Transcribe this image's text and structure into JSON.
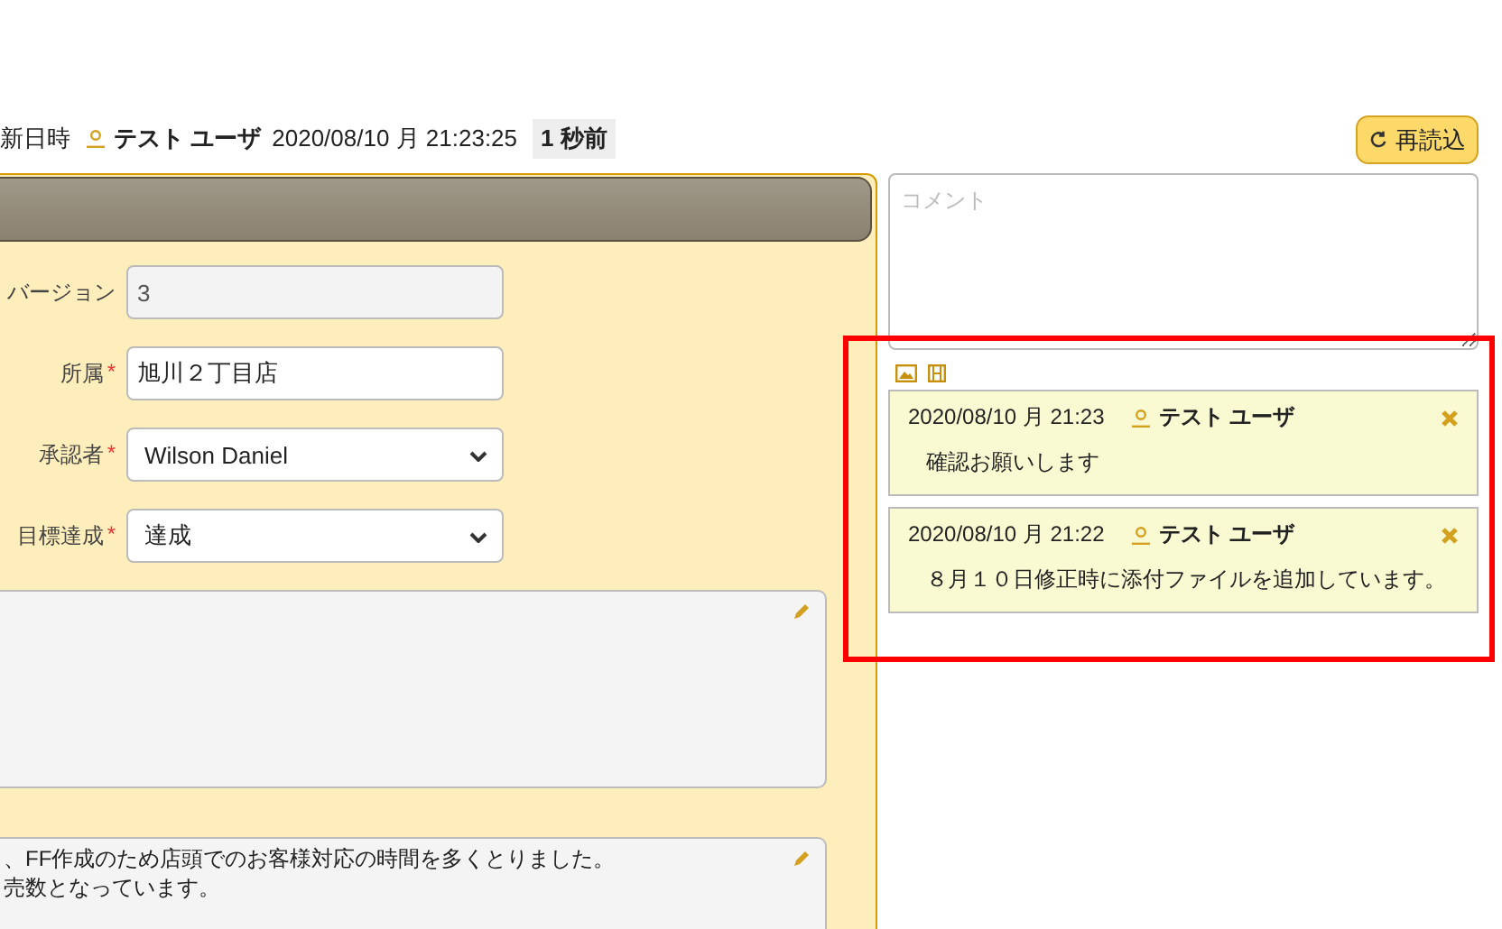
{
  "header": {
    "label": "新日時",
    "user": "テスト ユーザ",
    "timestamp": "2020/08/10 月 21:23:25",
    "ago": "1 秒前"
  },
  "reload_button": {
    "label": "再読込"
  },
  "required_mark": "*",
  "form": {
    "fields": [
      {
        "kind": "readonly",
        "label": "バージョン",
        "required": false,
        "value": "3"
      },
      {
        "kind": "text",
        "label": "所属",
        "required": true,
        "value": "旭川２丁目店"
      },
      {
        "kind": "select",
        "label": "承認者",
        "required": true,
        "value": "Wilson Daniel"
      },
      {
        "kind": "select",
        "label": "目標達成",
        "required": true,
        "value": "達成"
      }
    ]
  },
  "remarks": {
    "lines": [
      "、FF作成のため店頭でのお客様対応の時間を多くとりました。",
      "売数となっています。"
    ]
  },
  "comment_field": {
    "placeholder": "コメント"
  },
  "comments": [
    {
      "time": "2020/08/10 月 21:23",
      "user": "テスト ユーザ",
      "text": "確認お願いします"
    },
    {
      "time": "2020/08/10 月 21:22",
      "user": "テスト ユーザ",
      "text": "８月１０日修正時に添付ファイルを追加しています。"
    }
  ],
  "highlight": {
    "shown": true
  }
}
